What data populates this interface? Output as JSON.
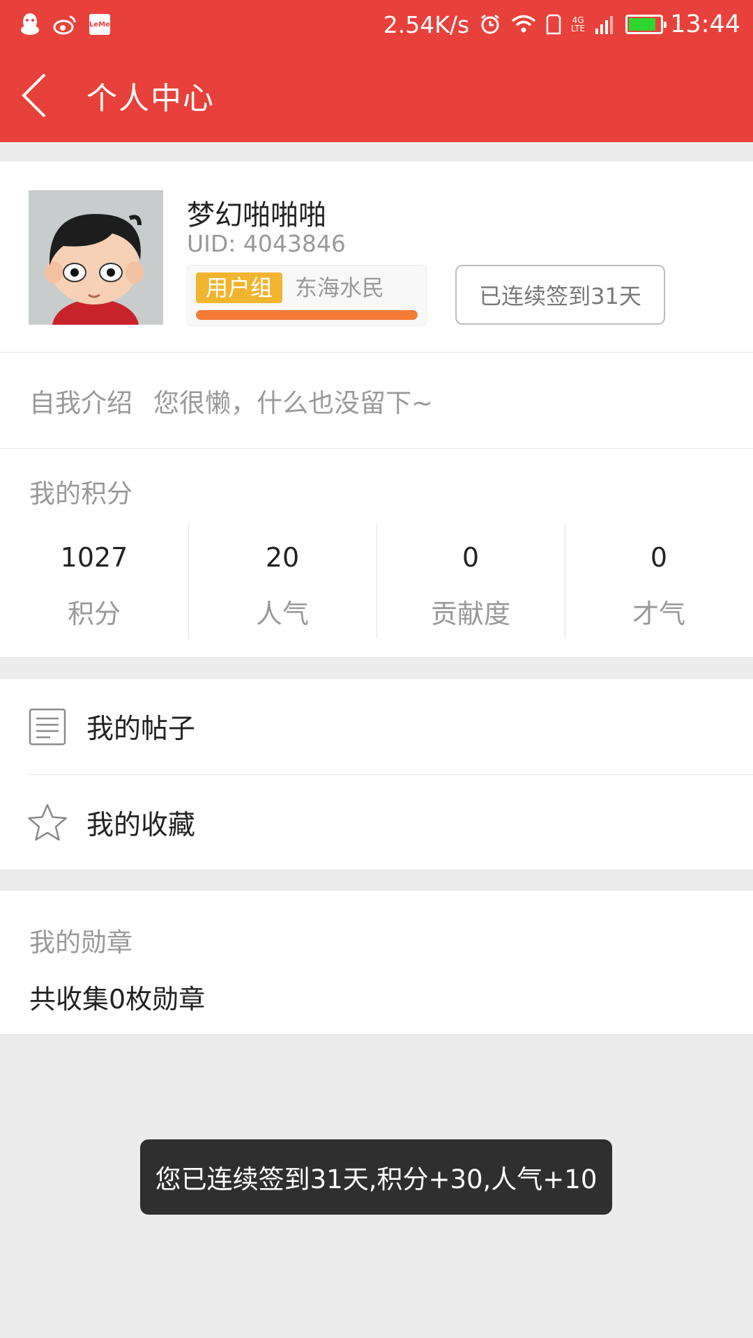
{
  "status_bar": {
    "left_icons": [
      "qq-icon",
      "weibo-icon",
      "leme-icon"
    ],
    "leme_text": "LeMe",
    "net_speed": "2.54K/s",
    "network_label_top": "4G",
    "network_label_bottom": "LTE",
    "time": "13:44",
    "battery_level": 0.85,
    "colors": {
      "bar": "#e8413b",
      "battery": "#2fd62f"
    }
  },
  "app_bar": {
    "title": "个人中心",
    "back_icon": "chevron-left-icon"
  },
  "profile": {
    "username": "梦幻啪啪啪",
    "uid": "UID: 4043846",
    "group_tag": "用户组",
    "group_name": "东海水民",
    "exp_progress": 1.0,
    "sign_in_label": "已连续签到31天",
    "colors": {
      "tag": "#f2b52f",
      "exp_bar": "#f67b36"
    }
  },
  "intro": {
    "label": "自我介绍",
    "text": "您很懒，什么也没留下~"
  },
  "points": {
    "title": "我的积分",
    "stats": [
      {
        "value": "1027",
        "label": "积分"
      },
      {
        "value": "20",
        "label": "人气"
      },
      {
        "value": "0",
        "label": "贡献度"
      },
      {
        "value": "0",
        "label": "才气"
      }
    ]
  },
  "menu": {
    "items": [
      {
        "label": "我的帖子",
        "icon": "document-icon"
      },
      {
        "label": "我的收藏",
        "icon": "star-icon"
      }
    ]
  },
  "medals": {
    "title": "我的勋章",
    "summary": "共收集0枚勋章"
  },
  "toast": {
    "text": "您已连续签到31天,积分+30,人气+10"
  }
}
